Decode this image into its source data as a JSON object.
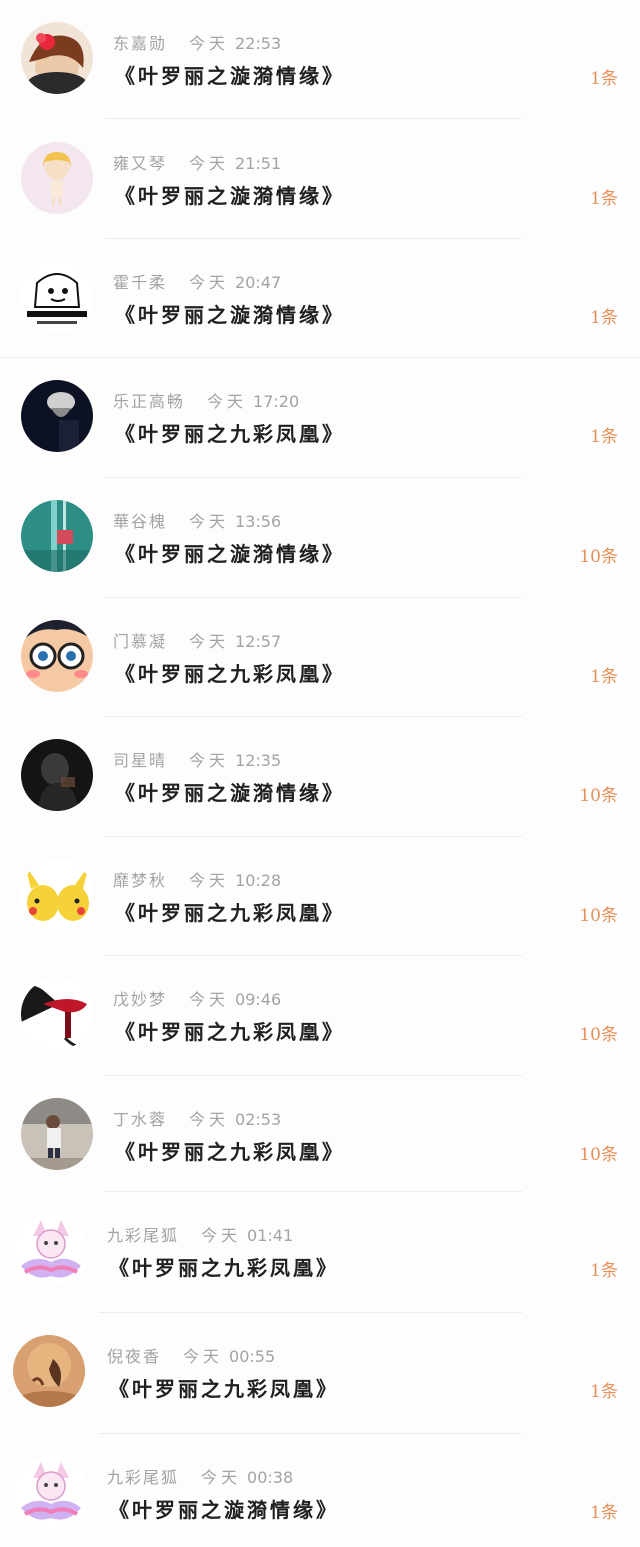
{
  "items": [
    {
      "name": "东嘉勋",
      "day": "今天",
      "time": "22:53",
      "title": "《叶罗丽之漩漪情缘》",
      "count": "1条",
      "avatar": "avatar-girl-red-flower"
    },
    {
      "name": "雍又琴",
      "day": "今天",
      "time": "21:51",
      "title": "《叶罗丽之漩漪情缘》",
      "count": "1条",
      "avatar": "avatar-cartoon-girl"
    },
    {
      "name": "霍千柔",
      "day": "今天",
      "time": "20:47",
      "title": "《叶罗丽之漩漪情缘》",
      "count": "1条",
      "avatar": "avatar-meme-sticker"
    },
    {
      "name": "乐正高畅",
      "day": "今天",
      "time": "17:20",
      "title": "《叶罗丽之九彩凤凰》",
      "count": "1条",
      "avatar": "avatar-dark-portrait"
    },
    {
      "name": "華谷槐",
      "day": "今天",
      "time": "13:56",
      "title": "《叶罗丽之漩漪情缘》",
      "count": "10条",
      "avatar": "avatar-teal-abstract"
    },
    {
      "name": "门慕凝",
      "day": "今天",
      "time": "12:57",
      "title": "《叶罗丽之九彩凤凰》",
      "count": "1条",
      "avatar": "avatar-anime-glasses-boy"
    },
    {
      "name": "司星晴",
      "day": "今天",
      "time": "12:35",
      "title": "《叶罗丽之漩漪情缘》",
      "count": "10条",
      "avatar": "avatar-dark-figure"
    },
    {
      "name": "靡梦秋",
      "day": "今天",
      "time": "10:28",
      "title": "《叶罗丽之九彩凤凰》",
      "count": "10条",
      "avatar": "avatar-pikachu"
    },
    {
      "name": "戊妙梦",
      "day": "今天",
      "time": "09:46",
      "title": "《叶罗丽之九彩凤凰》",
      "count": "10条",
      "avatar": "avatar-red-wine"
    },
    {
      "name": "丁水蓉",
      "day": "今天",
      "time": "02:53",
      "title": "《叶罗丽之九彩凤凰》",
      "count": "10条",
      "avatar": "avatar-child-photo"
    },
    {
      "name": "九彩尾狐",
      "day": "今天",
      "time": "01:41",
      "title": "《叶罗丽之九彩凤凰》",
      "count": "1条",
      "avatar": "avatar-pink-fox"
    },
    {
      "name": "倪夜香",
      "day": "今天",
      "time": "00:55",
      "title": "《叶罗丽之九彩凤凰》",
      "count": "1条",
      "avatar": "avatar-amber-painting"
    },
    {
      "name": "九彩尾狐",
      "day": "今天",
      "time": "00:38",
      "title": "《叶罗丽之漩漪情缘》",
      "count": "1条",
      "avatar": "avatar-pink-fox"
    }
  ]
}
